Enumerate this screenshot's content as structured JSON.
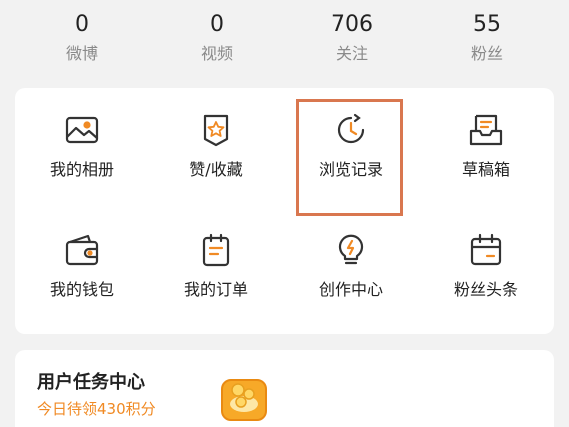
{
  "stats": [
    {
      "value": "0",
      "label": "微博"
    },
    {
      "value": "0",
      "label": "视频"
    },
    {
      "value": "706",
      "label": "关注"
    },
    {
      "value": "55",
      "label": "粉丝"
    }
  ],
  "grid": [
    {
      "label": "我的相册",
      "icon": "photo-album-icon"
    },
    {
      "label": "赞/收藏",
      "icon": "star-badge-icon"
    },
    {
      "label": "浏览记录",
      "icon": "history-clock-icon"
    },
    {
      "label": "草稿箱",
      "icon": "draft-box-icon"
    },
    {
      "label": "我的钱包",
      "icon": "wallet-icon"
    },
    {
      "label": "我的订单",
      "icon": "order-list-icon"
    },
    {
      "label": "创作中心",
      "icon": "lightbulb-icon"
    },
    {
      "label": "粉丝头条",
      "icon": "calendar-icon"
    }
  ],
  "task": {
    "title": "用户任务中心",
    "subtitle": "今日待领430积分",
    "icon": "reward-gift-icon"
  },
  "colors": {
    "accent": "#f08a24",
    "highlight_border": "#d9774f",
    "icon_stroke": "#333333"
  }
}
